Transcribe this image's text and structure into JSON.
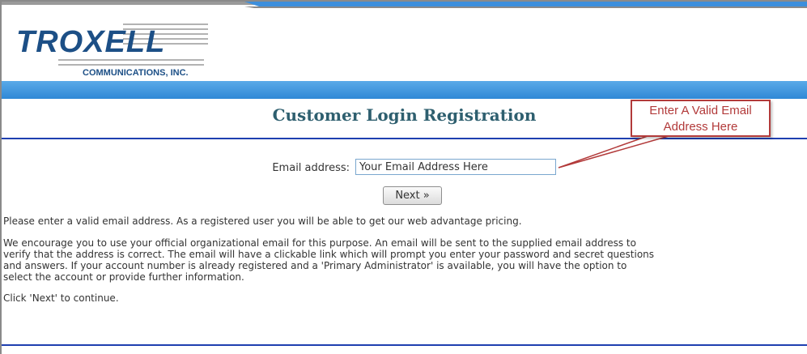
{
  "brand": {
    "logo_text": "TROXELL",
    "logo_subtext": "COMMUNICATIONS, INC.",
    "primary_color": "#1c4f86",
    "band_color": "#2f88d6"
  },
  "page": {
    "title": "Customer Login Registration"
  },
  "form": {
    "email_label": "Email address:",
    "email_value": "Your Email Address Here",
    "next_label": "Next »"
  },
  "paragraphs": {
    "p1": "Please enter a valid email address. As a registered user you will be able to get our web advantage pricing.",
    "p2": [
      "We encourage you to use your official organizational email for this purpose. An email will be sent to the supplied email address to",
      "verify that the address is correct. The email will have a clickable link which will prompt you enter your password and secret questions",
      "and answers. If your account number is already registered and a 'Primary Administrator' is available, you will have the option to",
      "select the account or provide further information."
    ],
    "p3": "Click 'Next' to continue."
  },
  "callout": {
    "line1": "Enter A Valid Email",
    "line2": "Address Here",
    "color": "#b23a3a"
  }
}
